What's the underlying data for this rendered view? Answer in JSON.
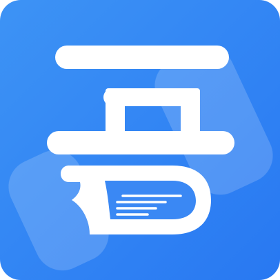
{
  "icon": {
    "name": "wu-book-logo-icon",
    "colors": {
      "background_top": "#3d93f5",
      "background_bottom": "#2878f2",
      "glyph": "#ffffff",
      "book_inner": "#3a88f4",
      "watermark": "#5aa2f6"
    }
  }
}
